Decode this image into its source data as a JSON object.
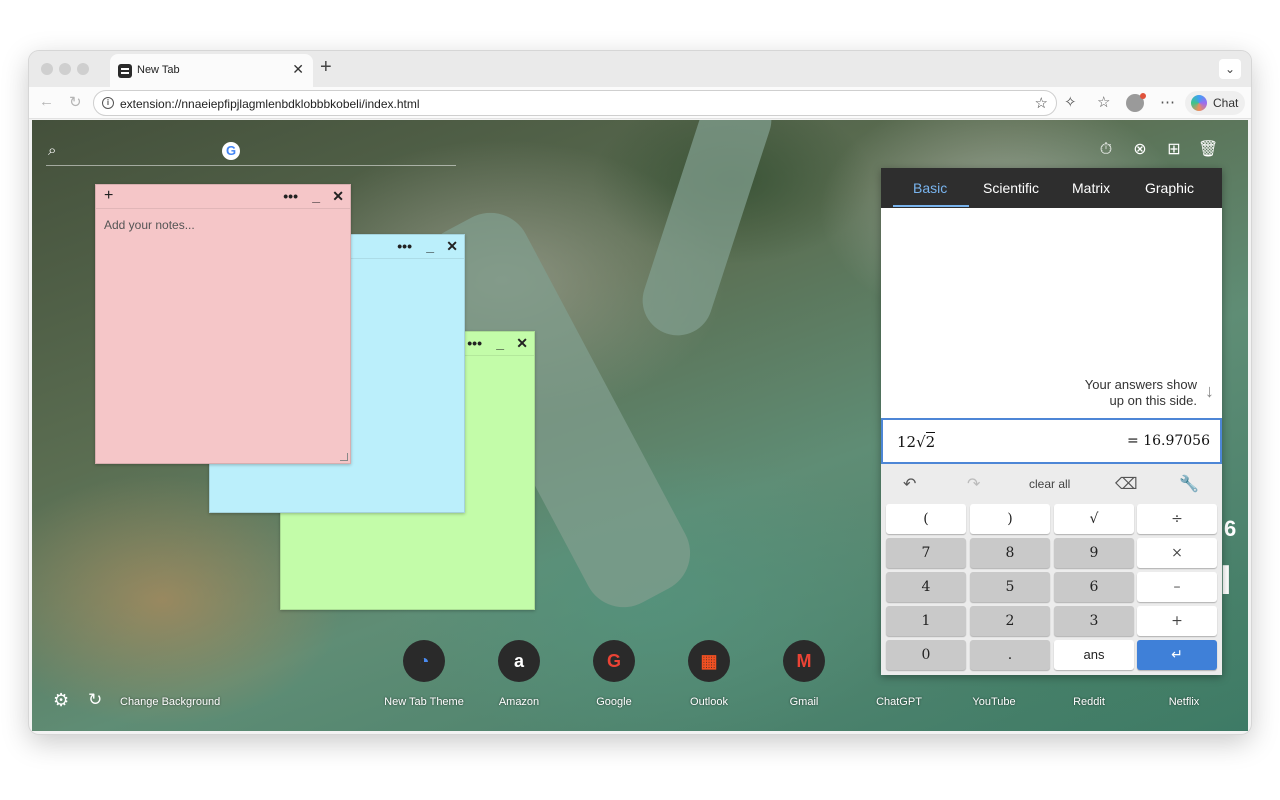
{
  "browser": {
    "tab_title": "New Tab",
    "tab_close": "✕",
    "new_tab": "+",
    "tab_menu": "⌄",
    "url": "extension://nnaeiepfipjlagmlenbdklobbbkobeli/index.html",
    "chat_label": "Chat"
  },
  "sticky_notes": {
    "placeholder": "Add your notes...",
    "add": "+",
    "menu": "•••",
    "minimize": "_",
    "close": "✕"
  },
  "calculator": {
    "tabs": [
      "Basic",
      "Scientific",
      "Matrix",
      "Graphic"
    ],
    "active_tab": "Basic",
    "hint_line1": "Your answers show",
    "hint_line2": "up on this side.",
    "expression_coeff": "12",
    "expression_radical": "√",
    "expression_radicand": "2",
    "result": "= 16.97056",
    "clear_all": "clear all",
    "keys": {
      "lparen": "(",
      "rparen": ")",
      "sqrt": "√",
      "divide": "÷",
      "k7": "7",
      "k8": "8",
      "k9": "9",
      "multiply": "×",
      "k4": "4",
      "k5": "5",
      "k6": "6",
      "minus": "–",
      "k1": "1",
      "k2": "2",
      "k3": "3",
      "plus": "+",
      "k0": "0",
      "dot": ".",
      "ans": "ans",
      "enter": "↵"
    }
  },
  "peek_text": {
    "digit": "6",
    "bar": "I"
  },
  "shortcuts": [
    {
      "label": "New Tab Theme",
      "icon": "compass-icon",
      "glyph": "◔"
    },
    {
      "label": "Amazon",
      "icon": "amazon-icon",
      "glyph": "a"
    },
    {
      "label": "Google",
      "icon": "google-icon",
      "glyph": "G"
    },
    {
      "label": "Outlook",
      "icon": "microsoft-icon",
      "glyph": "▦"
    },
    {
      "label": "Gmail",
      "icon": "gmail-icon",
      "glyph": "M"
    },
    {
      "label": "ChatGPT",
      "icon": "chatgpt-icon",
      "glyph": ""
    },
    {
      "label": "YouTube",
      "icon": "youtube-icon",
      "glyph": ""
    },
    {
      "label": "Reddit",
      "icon": "reddit-icon",
      "glyph": ""
    },
    {
      "label": "Netflix",
      "icon": "netflix-icon",
      "glyph": ""
    }
  ],
  "footer": {
    "change_background": "Change Background"
  },
  "colors": {
    "note_pink": "#f5c6c8",
    "note_blue": "#bbeffb",
    "note_green": "#c3fca9",
    "calc_accent": "#79b4ee",
    "enter_key": "#3f80d8"
  }
}
